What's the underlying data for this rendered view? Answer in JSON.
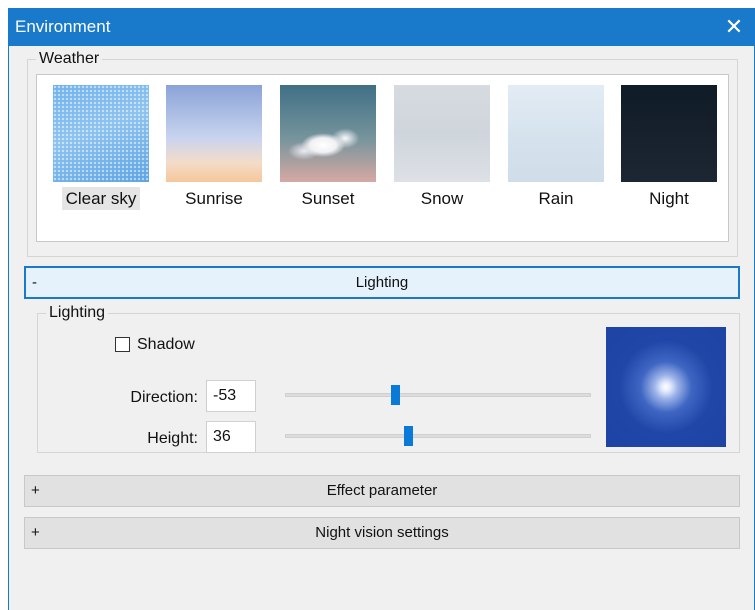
{
  "window": {
    "title": "Environment",
    "close_glyph": "✕",
    "accent_color": "#1979ca"
  },
  "weather": {
    "legend": "Weather",
    "items": [
      {
        "label": "Clear sky",
        "selected": true
      },
      {
        "label": "Sunrise",
        "selected": false
      },
      {
        "label": "Sunset",
        "selected": false
      },
      {
        "label": "Snow",
        "selected": false
      },
      {
        "label": "Rain",
        "selected": false
      },
      {
        "label": "Night",
        "selected": false
      }
    ]
  },
  "sections": {
    "lighting": {
      "sign": "-",
      "title": "Lighting",
      "expanded": true
    },
    "effect": {
      "sign": "+",
      "title": "Effect parameter",
      "expanded": false
    },
    "night_vision": {
      "sign": "+",
      "title": "Night vision settings",
      "expanded": false
    }
  },
  "lighting": {
    "legend": "Lighting",
    "shadow": {
      "label": "Shadow",
      "checked": false
    },
    "direction": {
      "label": "Direction:",
      "value": "-53",
      "slider_fraction": 0.36
    },
    "height": {
      "label": "Height:",
      "value": "36",
      "slider_fraction": 0.4
    },
    "preview_color": "#1d44a4"
  }
}
